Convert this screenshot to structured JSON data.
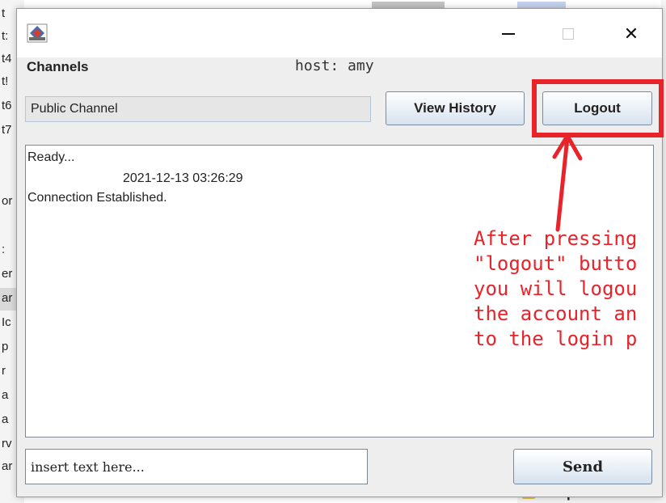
{
  "background": {
    "left_fragments": [
      "t",
      "t:",
      "t4",
      "t!",
      "t6",
      "t7",
      "or",
      ":",
      "er",
      "ar",
      "Ic",
      "p",
      "r",
      "a",
      "a",
      "rv",
      "ar"
    ],
    "bottom_folder_text": "components"
  },
  "window": {
    "controls": {
      "minimize": "—",
      "maximize": "☐",
      "close": "✕"
    }
  },
  "header": {
    "channels_label": "Channels",
    "host_label": "host: amy"
  },
  "channel_field": {
    "value": "Public Channel"
  },
  "buttons": {
    "view_history": "View History",
    "logout": "Logout",
    "send": "Send"
  },
  "messages": [
    "Ready...",
    "2021-12-13 03:26:29",
    "Connection Established."
  ],
  "input": {
    "placeholder": "insert text here..."
  },
  "annotation": {
    "color": "#e8232a",
    "lines": [
      "After pressing",
      "\"logout\" butto",
      "you will logou",
      "the account an",
      "to the login p"
    ]
  }
}
